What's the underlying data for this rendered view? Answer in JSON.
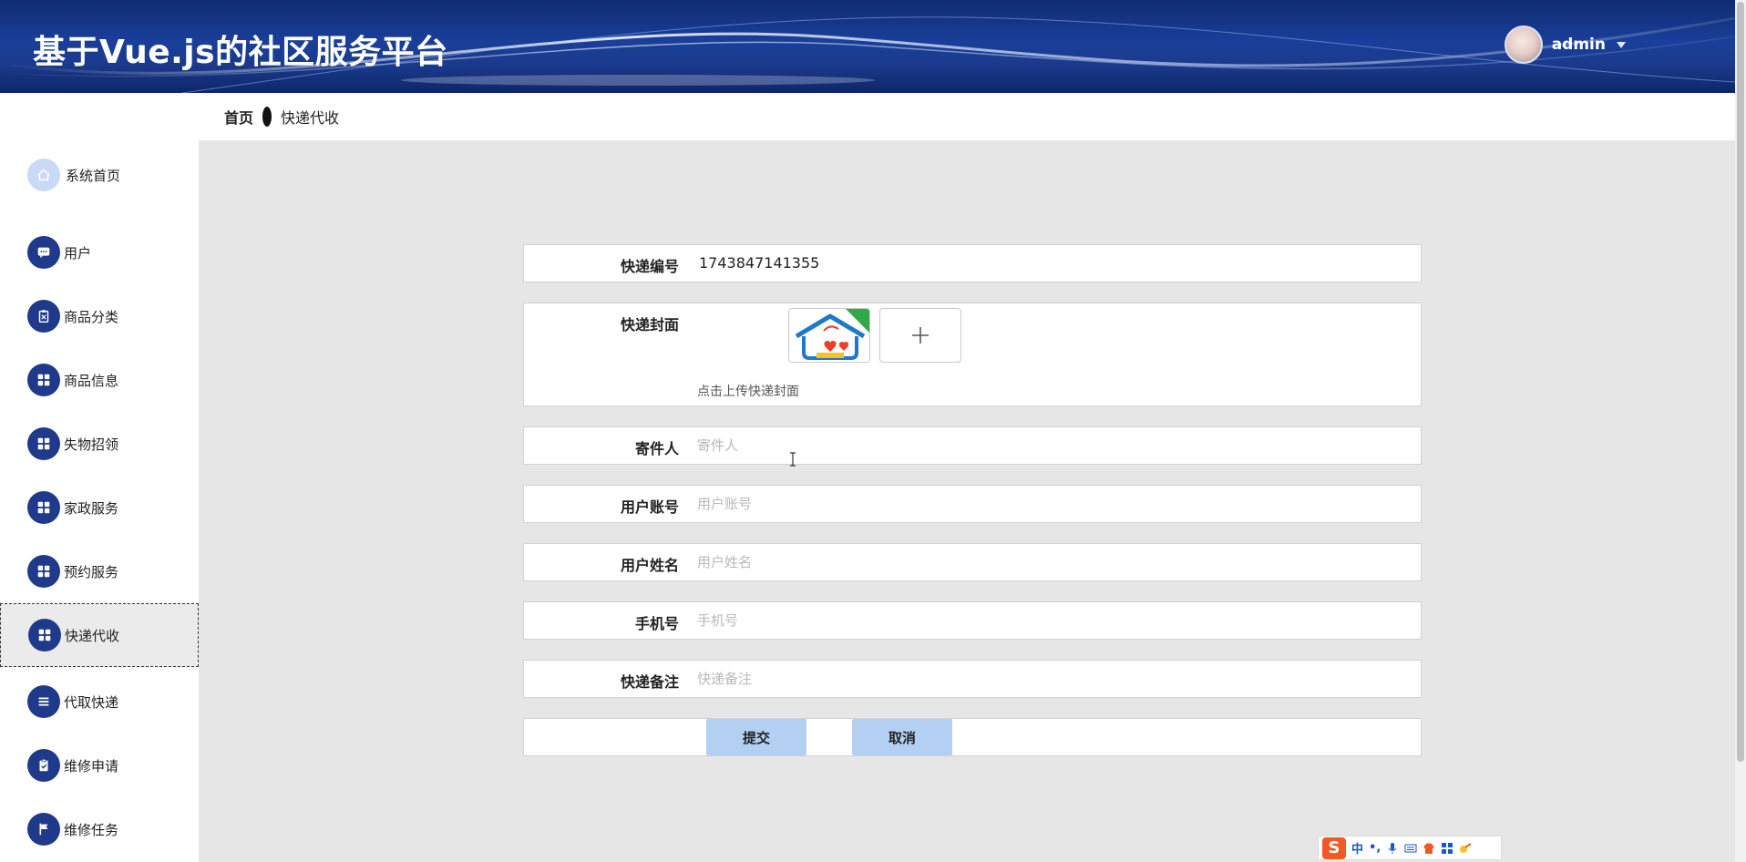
{
  "header": {
    "title": "基于Vue.js的社区服务平台",
    "username": "admin"
  },
  "breadcrumb": {
    "home": "首页",
    "current": "快递代收"
  },
  "sidebar": {
    "items": [
      {
        "label": "系统首页",
        "icon": "home-icon"
      },
      {
        "label": "用户",
        "icon": "chat-icon"
      },
      {
        "label": "商品分类",
        "icon": "clipboard-icon"
      },
      {
        "label": "商品信息",
        "icon": "grid-icon"
      },
      {
        "label": "失物招领",
        "icon": "grid-icon"
      },
      {
        "label": "家政服务",
        "icon": "grid-icon"
      },
      {
        "label": "预约服务",
        "icon": "grid-icon"
      },
      {
        "label": "快递代收",
        "icon": "grid-icon",
        "active": true
      },
      {
        "label": "代取快递",
        "icon": "list-icon"
      },
      {
        "label": "维修申请",
        "icon": "clipboard-check-icon"
      },
      {
        "label": "维修任务",
        "icon": "flag-icon"
      }
    ]
  },
  "form": {
    "express_no": {
      "label": "快递编号",
      "value": "1743847141355"
    },
    "cover": {
      "label": "快递封面",
      "tip": "点击上传快递封面",
      "add_symbol": "+"
    },
    "sender": {
      "label": "寄件人",
      "placeholder": "寄件人"
    },
    "user_account": {
      "label": "用户账号",
      "placeholder": "用户账号"
    },
    "user_name": {
      "label": "用户姓名",
      "placeholder": "用户姓名"
    },
    "phone": {
      "label": "手机号",
      "placeholder": "手机号"
    },
    "remark": {
      "label": "快递备注",
      "placeholder": "快递备注"
    },
    "submit_label": "提交",
    "cancel_label": "取消"
  },
  "ime": {
    "logo": "S",
    "mode": "中",
    "punct": "•,"
  },
  "colors": {
    "header_bg": "#1a3f9a",
    "menu_icon_bg": "#1f3a8a",
    "button_bg": "#b3d0f3",
    "main_bg": "#e6e6e6"
  }
}
